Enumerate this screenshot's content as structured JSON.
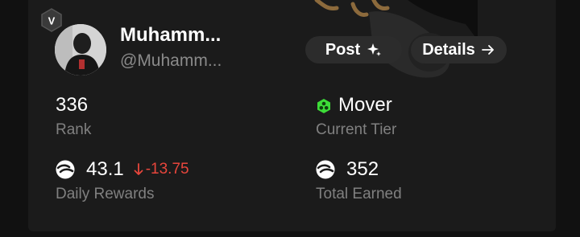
{
  "profile": {
    "badge_letter": "V",
    "name": "Muhamm...",
    "handle": "@Muhamm..."
  },
  "actions": {
    "post_label": "Post",
    "details_label": "Details"
  },
  "stats": {
    "rank": {
      "value": "336",
      "label": "Rank"
    },
    "tier": {
      "value": "Mover",
      "label": "Current Tier",
      "icon": "mover-tier-icon",
      "icon_color": "#3ddc38"
    },
    "daily_rewards": {
      "value": "43.1",
      "change": "-13.75",
      "label": "Daily Rewards",
      "change_color": "#e8463c"
    },
    "total_earned": {
      "value": "352",
      "label": "Total Earned"
    }
  },
  "colors": {
    "page_bg": "#111111",
    "card_bg": "#1b1b1b",
    "button_bg": "#2c2c2c",
    "label_text": "#808080"
  }
}
